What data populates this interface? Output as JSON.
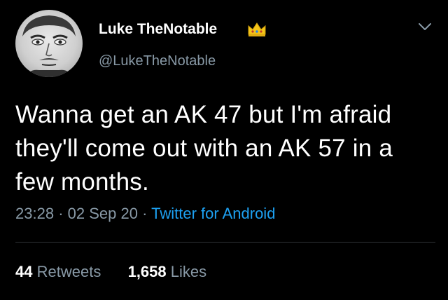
{
  "author": {
    "display_name": "Luke TheNotable",
    "handle": "@LukeTheNotable",
    "badge_icon": "crown-icon"
  },
  "tweet": {
    "lines": [
      "Wanna get an AK 47 but I'm afraid",
      "they'll come out with an AK 57 in a",
      "few months."
    ],
    "time": "23:28",
    "separator": "·",
    "date": "02 Sep 20",
    "source": "Twitter for Android"
  },
  "stats": {
    "retweets_count": "44",
    "retweets_label": "Retweets",
    "likes_count": "1,658",
    "likes_label": "Likes"
  },
  "colors": {
    "background": "#000000",
    "text": "#ffffff",
    "muted": "#8899a6",
    "link": "#1da1f2",
    "crown": "#f5c518"
  }
}
